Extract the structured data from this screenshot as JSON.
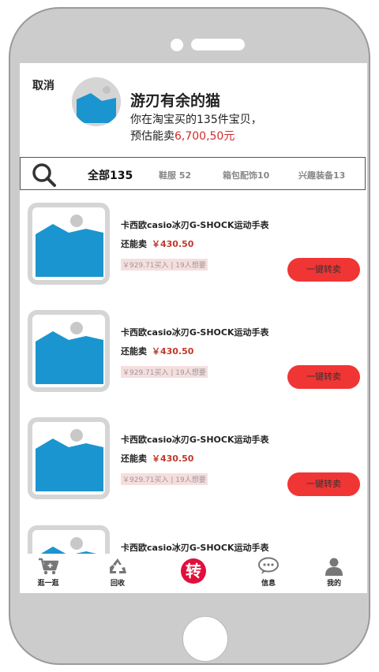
{
  "header": {
    "cancel_label": "取消",
    "shop_name": "游刃有余的猫",
    "line1": "你在淘宝买的135件宝贝，",
    "line2_prefix": "预估能卖",
    "line2_amount": "6,700,50元"
  },
  "tabs": [
    {
      "label": "全部135",
      "active": true
    },
    {
      "label": "鞋服 52",
      "active": false
    },
    {
      "label": "箱包配饰10",
      "active": false
    },
    {
      "label": "兴趣装备13",
      "active": false
    }
  ],
  "items": [
    {
      "title": "卡西欧casio冰刃G-SHOCK运动手表",
      "price_label": "还能卖",
      "price": "￥430.50",
      "meta": "￥929.71买入 | 19人想要",
      "button": "一键转卖"
    },
    {
      "title": "卡西欧casio冰刃G-SHOCK运动手表",
      "price_label": "还能卖",
      "price": "￥430.50",
      "meta": "￥929.71买入 | 19人想要",
      "button": "一键转卖"
    },
    {
      "title": "卡西欧casio冰刃G-SHOCK运动手表",
      "price_label": "还能卖",
      "price": "￥430.50",
      "meta": "￥929.71买入 | 19人想要",
      "button": "一键转卖"
    },
    {
      "title": "卡西欧casio冰刃G-SHOCK运动手表"
    }
  ],
  "nav": [
    {
      "label": "逛一逛",
      "icon": "cart-icon"
    },
    {
      "label": "回收",
      "icon": "recycle-icon"
    },
    {
      "label": "转",
      "icon": "transfer-icon"
    },
    {
      "label": "信息",
      "icon": "chat-icon"
    },
    {
      "label": "我的",
      "icon": "user-icon"
    }
  ],
  "colors": {
    "accent": "#f03535",
    "price": "#c0392b",
    "image_blue": "#1b95cf",
    "image_bg": "#d5d5d5"
  }
}
